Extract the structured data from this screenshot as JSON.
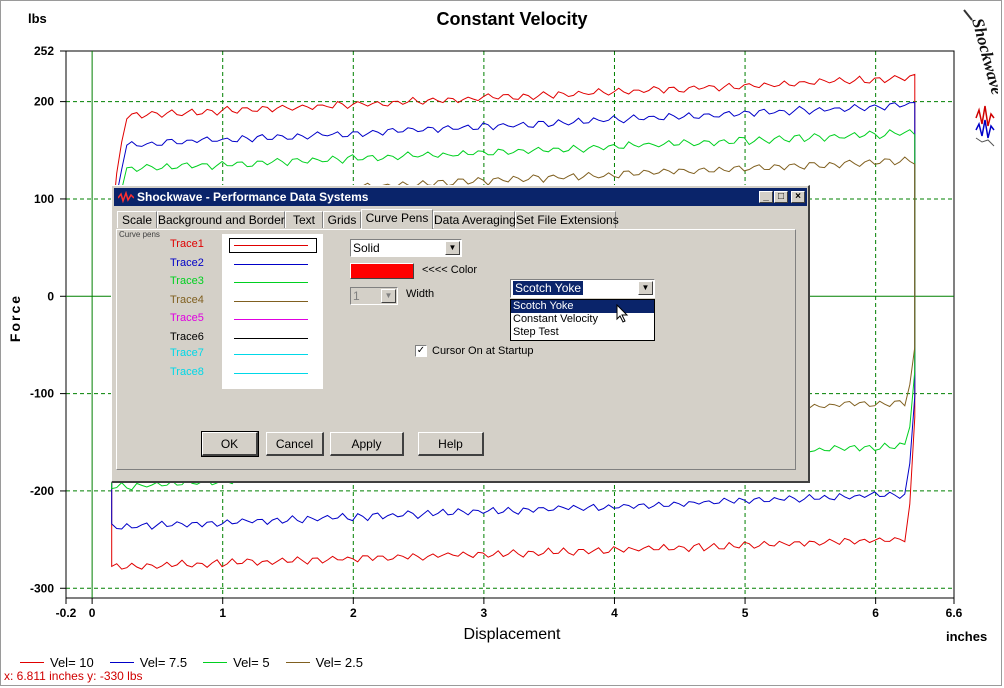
{
  "chart_data": {
    "type": "line",
    "title": "Constant Velocity",
    "xlabel": "Displacement",
    "ylabel": "Force",
    "x_unit": "inches",
    "y_unit": "lbs",
    "xlim": [
      -0.2,
      6.6
    ],
    "ylim": [
      -310,
      252
    ],
    "x_ticks": [
      -0.2,
      0,
      1,
      2,
      3,
      4,
      5,
      6,
      6.6
    ],
    "x_tick_labels": [
      "-0.2",
      "0",
      "1",
      "2",
      "3",
      "4",
      "5",
      "6",
      "6.6"
    ],
    "y_ticks": [
      252,
      200,
      100,
      0,
      -100,
      -200,
      -300
    ],
    "y_tick_labels": [
      "252",
      "200",
      "100",
      "0",
      "-100",
      "-200",
      "-300"
    ],
    "grid": true,
    "legend_position": "bottom-left",
    "series": [
      {
        "name": "Vel= 10",
        "color": "#e00000",
        "x_start": 0.15,
        "x_end": 6.3,
        "upper": [
          185,
          225
        ],
        "lower": [
          -278,
          -250
        ]
      },
      {
        "name": "Vel= 7.5",
        "color": "#0000c8",
        "x_start": 0.15,
        "x_end": 6.3,
        "upper": [
          155,
          197
        ],
        "lower": [
          -237,
          -203
        ]
      },
      {
        "name": "Vel= 5",
        "color": "#00d020",
        "x_start": 0.15,
        "x_end": 6.3,
        "upper": [
          130,
          168
        ],
        "lower": [
          -196,
          -153
        ]
      },
      {
        "name": "Vel= 2.5",
        "color": "#806020",
        "x_start": 0.15,
        "x_end": 6.3,
        "upper": [
          100,
          140
        ],
        "lower": [
          -148,
          -108
        ]
      }
    ]
  },
  "logo": {
    "text": "Shockwave"
  },
  "cursor_readout": "x: 6.811 inches  y: -330 lbs",
  "dialog": {
    "title": "Shockwave - Performance Data Systems",
    "icon": "shockwave-waveform-icon",
    "window_buttons": {
      "minimize": "_",
      "maximize": "□",
      "close": "×"
    },
    "tabs": [
      "Scale",
      "Background and Borders",
      "Text",
      "Grids",
      "Curve Pens",
      "Data Averaging",
      "Set File Extensions"
    ],
    "active_tab": "Curve Pens",
    "curve_pens_label": "Curve pens",
    "traces": [
      {
        "label": "Trace1",
        "color": "#e00000"
      },
      {
        "label": "Trace2",
        "color": "#0000c8"
      },
      {
        "label": "Trace3",
        "color": "#00d020"
      },
      {
        "label": "Trace4",
        "color": "#806020"
      },
      {
        "label": "Trace5",
        "color": "#e000e0"
      },
      {
        "label": "Trace6",
        "color": "#000000"
      },
      {
        "label": "Trace7",
        "color": "#00d8e8"
      },
      {
        "label": "Trace8",
        "color": "#00d8e8"
      }
    ],
    "line_style": "Solid",
    "color_label": "<<<< Color",
    "pen_color": "#ff0000",
    "width_value": "1",
    "width_label": "Width",
    "test_type": {
      "selected": "Scotch Yoke",
      "options": [
        "Scotch Yoke",
        "Constant Velocity",
        "Step Test"
      ],
      "highlighted": "Scotch Yoke"
    },
    "cursor_checkbox": {
      "label": "Cursor On at Startup",
      "checked": true
    },
    "buttons": {
      "ok": "OK",
      "cancel": "Cancel",
      "apply": "Apply",
      "help": "Help"
    }
  }
}
